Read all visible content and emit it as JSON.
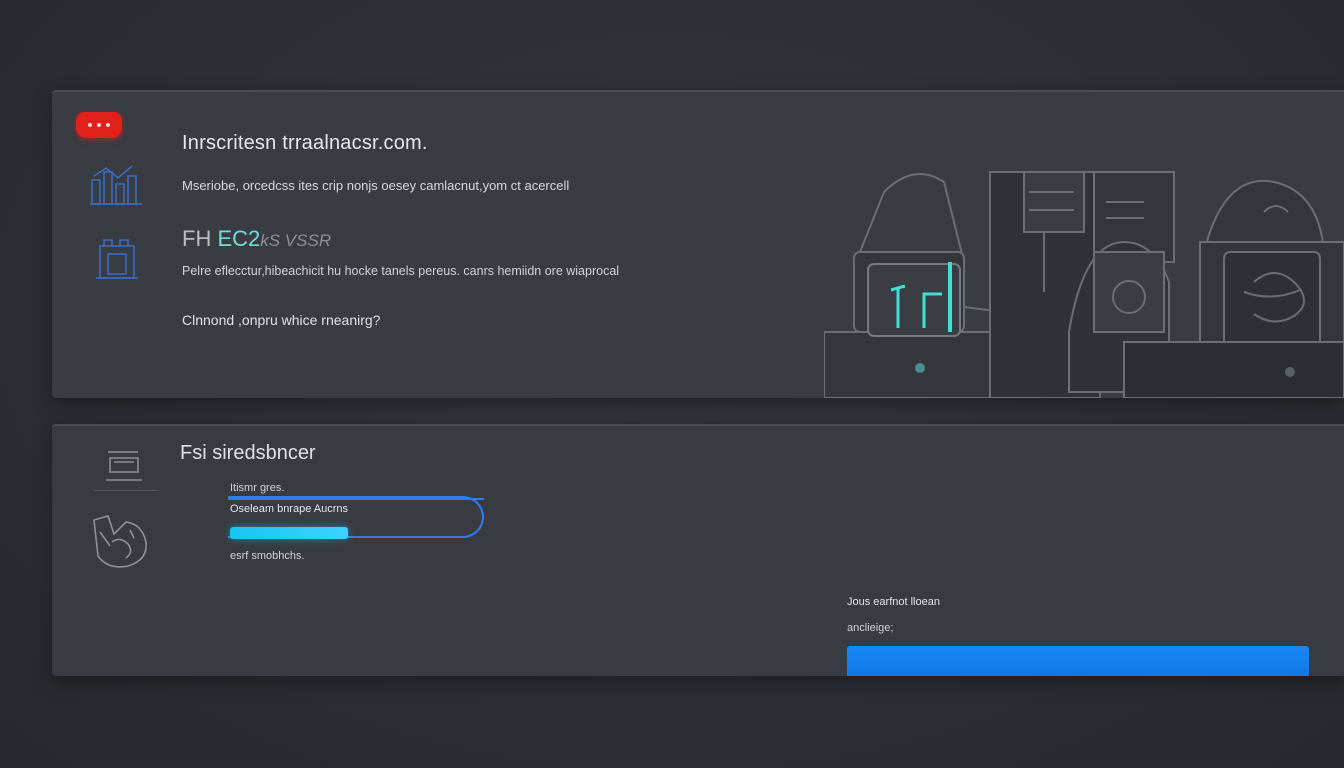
{
  "top_panel": {
    "title": "Inrscritesn trraalnacsr.com.",
    "description": "Mseriobe, orcedcss ites crip nonjs oesey camlacnut,yom ct acercell",
    "heading2_prefix": "FH",
    "heading2_accent": "EC2",
    "heading2_suffix": "kS VSSR",
    "body": "Pelre eflecctur,hibeachicit hu hocke tanels pereus. canrs hemiidn ore wiaprocal",
    "question": "Clnnond ,onpru whice rneanirg?",
    "icons": [
      "alert-badge",
      "chart-icon",
      "folder-icon",
      "devices-illustration"
    ]
  },
  "bottom_panel": {
    "title": "Fsi siredsbncer",
    "field_small_label": "Itismr gres.",
    "field_label": "Oseleam bnrape Aucrns",
    "progress": 0.46,
    "helper_text": "esrf smobhchs.",
    "right_label_1": "Jous earfnot lloean",
    "right_label_2": "anclieige;",
    "button_label": "",
    "icons": [
      "bucket-icon",
      "hand-icon"
    ]
  },
  "colors": {
    "accent_blue": "#2f7df0",
    "progress_cyan": "#18c6f2",
    "alert_red": "#e0201b",
    "teal_accent": "#6fe0d9"
  }
}
